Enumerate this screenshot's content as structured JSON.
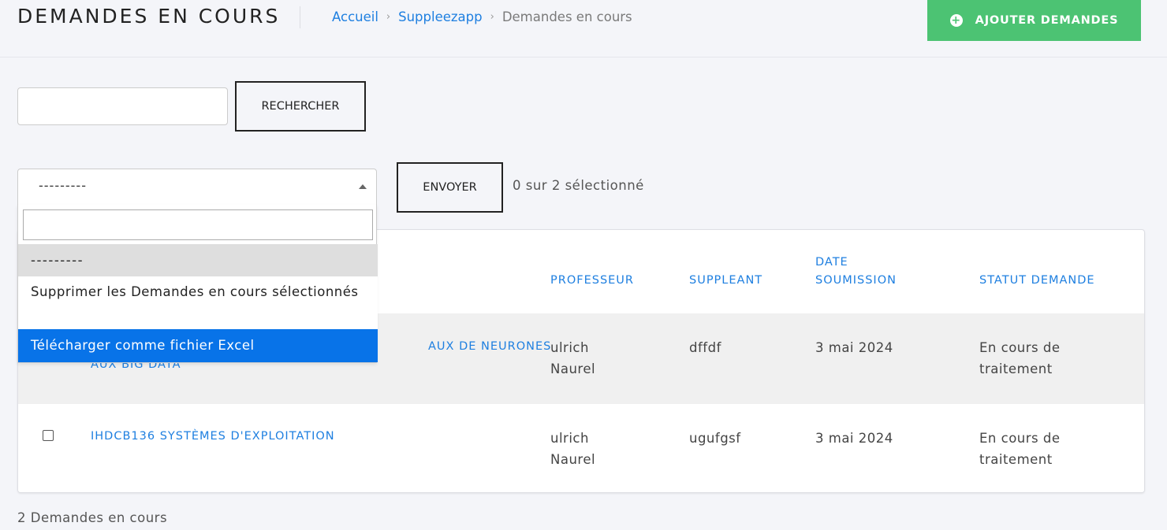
{
  "header": {
    "title": "DEMANDES EN COURS",
    "breadcrumb": [
      "Accueil",
      "Suppleezapp",
      "Demandes en cours"
    ],
    "breadcrumb_separator": "›",
    "add_button": "AJOUTER DEMANDES",
    "add_icon": "+"
  },
  "search": {
    "value": "",
    "button": "RECHERCHER"
  },
  "actions": {
    "selected_value": "---------",
    "send_button": "ENVOYER",
    "selection_count": "0 sur 2 sélectionné",
    "dropdown": {
      "search_value": "",
      "options": [
        "---------",
        "Supprimer les Demandes en cours sélectionnés",
        "Télécharger comme fichier Excel"
      ],
      "highlighted_index": 2
    }
  },
  "table": {
    "headers": {
      "professeur": "PROFESSEUR",
      "suppleant": "SUPPLEANT",
      "date_line1": "DATE",
      "date_line2": "SOUMISSION",
      "statut": "STATUT DEMANDE"
    },
    "rows": [
      {
        "course_line1": "AUX DE NEURONES",
        "course_line2": "AUX BIG DATA",
        "prof_line1": "ulrich",
        "prof_line2": "Naurel",
        "suppleant": "dffdf",
        "date": "3 mai 2024",
        "statut_line1": "En cours de",
        "statut_line2": "traitement"
      },
      {
        "course_line1": "IHDCB136 SYSTÈMES D'EXPLOITATION",
        "prof_line1": "ulrich",
        "prof_line2": "Naurel",
        "suppleant": "ugufgsf",
        "date": "3 mai 2024",
        "statut_line1": "En cours de",
        "statut_line2": "traitement"
      }
    ]
  },
  "footer": {
    "count": "2 Demandes en cours"
  },
  "colors": {
    "accent_blue": "#1e7fe0",
    "add_green": "#4cc373",
    "highlight_blue": "#0873e8"
  }
}
